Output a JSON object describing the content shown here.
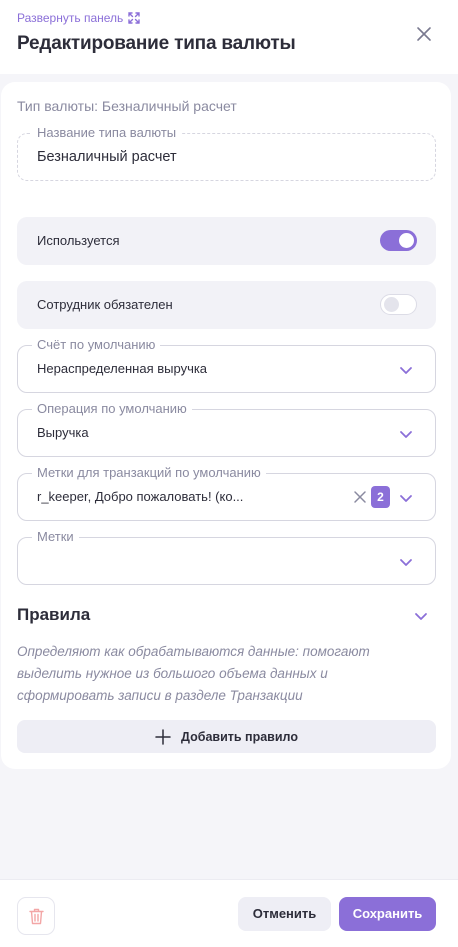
{
  "colors": {
    "accent": "#8b6fd8",
    "text": "#2d2d3a",
    "muted": "#8a8aa0",
    "background": "#f5f5f9",
    "danger": "#f3a6a6"
  },
  "header": {
    "expand_label": "Развернуть панель",
    "expand_icon": "expand-icon",
    "title": "Редактирование типа валюты",
    "close_icon": "close-icon"
  },
  "form": {
    "subtitle": "Тип валюты: Безналичный расчет",
    "name_field": {
      "label": "Название типа валюты",
      "value": "Безналичный расчет"
    },
    "used_toggle": {
      "label": "Используется",
      "on": true
    },
    "employee_toggle": {
      "label": "Сотрудник обязателен",
      "on": false
    },
    "default_account": {
      "label": "Счёт по умолчанию",
      "value": "Нераспределенная выручка"
    },
    "default_operation": {
      "label": "Операция по умолчанию",
      "value": "Выручка"
    },
    "default_tags": {
      "label": "Метки для транзакций по умолчанию",
      "value": "r_keeper, Добро пожаловать! (ко...",
      "count": "2"
    },
    "tags": {
      "label": "Метки",
      "value": ""
    }
  },
  "rules": {
    "title": "Правила",
    "description": "Определяют как обрабатываются данные: помогают выделить нужное из большого объема данных и сформировать записи в разделе Транзакции",
    "add_label": "Добавить правило"
  },
  "footer": {
    "delete_icon": "trash-icon",
    "cancel_label": "Отменить",
    "save_label": "Сохранить"
  }
}
